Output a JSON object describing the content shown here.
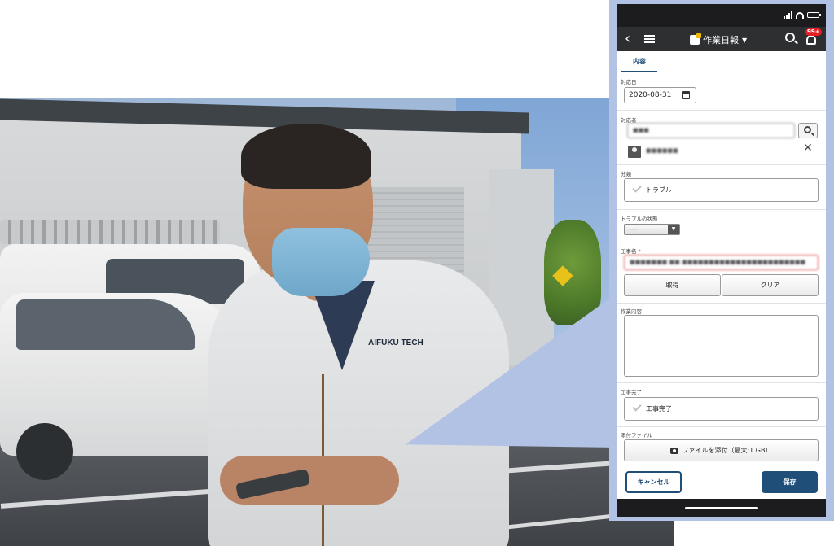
{
  "photo": {
    "jacket_brand": "AIFUKU TECH"
  },
  "app": {
    "title": "作業日報",
    "notification_badge": "99+",
    "tab_label": "内容"
  },
  "form": {
    "date": {
      "label": "対応日",
      "value": "2020-08-31"
    },
    "assignee": {
      "label": "対応者",
      "input_value": "■■■",
      "user_name": "■■■■■■"
    },
    "category": {
      "label": "分類",
      "option": "トラブル"
    },
    "trouble_status": {
      "label": "トラブルの状態",
      "selected": "-----"
    },
    "project_name": {
      "label": "工事名",
      "required_mark": "*",
      "value": "■■■■■■■ ■■ ■■■■■■■■■■■■■■■■■■■■■■■"
    },
    "fetch_button": "取得",
    "clear_button": "クリア",
    "work_content": {
      "label": "作業内容",
      "value": ""
    },
    "work_complete": {
      "label": "工事完了",
      "option": "工事完了"
    },
    "attachment": {
      "label": "添付ファイル",
      "button": "ファイルを添付（最大:1 GB）"
    },
    "cancel_button": "キャンセル",
    "save_button": "保存"
  },
  "colors": {
    "primary": "#1f4e79",
    "appbar": "#2e2f31",
    "frame": "#b1c2e4",
    "badge": "#e21f26",
    "required": "#c0392b"
  },
  "icons": [
    "back-icon",
    "menu-icon",
    "daily-report-icon",
    "search-icon",
    "bell-icon",
    "calendar-icon",
    "user-icon",
    "close-icon",
    "check-icon",
    "camera-icon"
  ]
}
